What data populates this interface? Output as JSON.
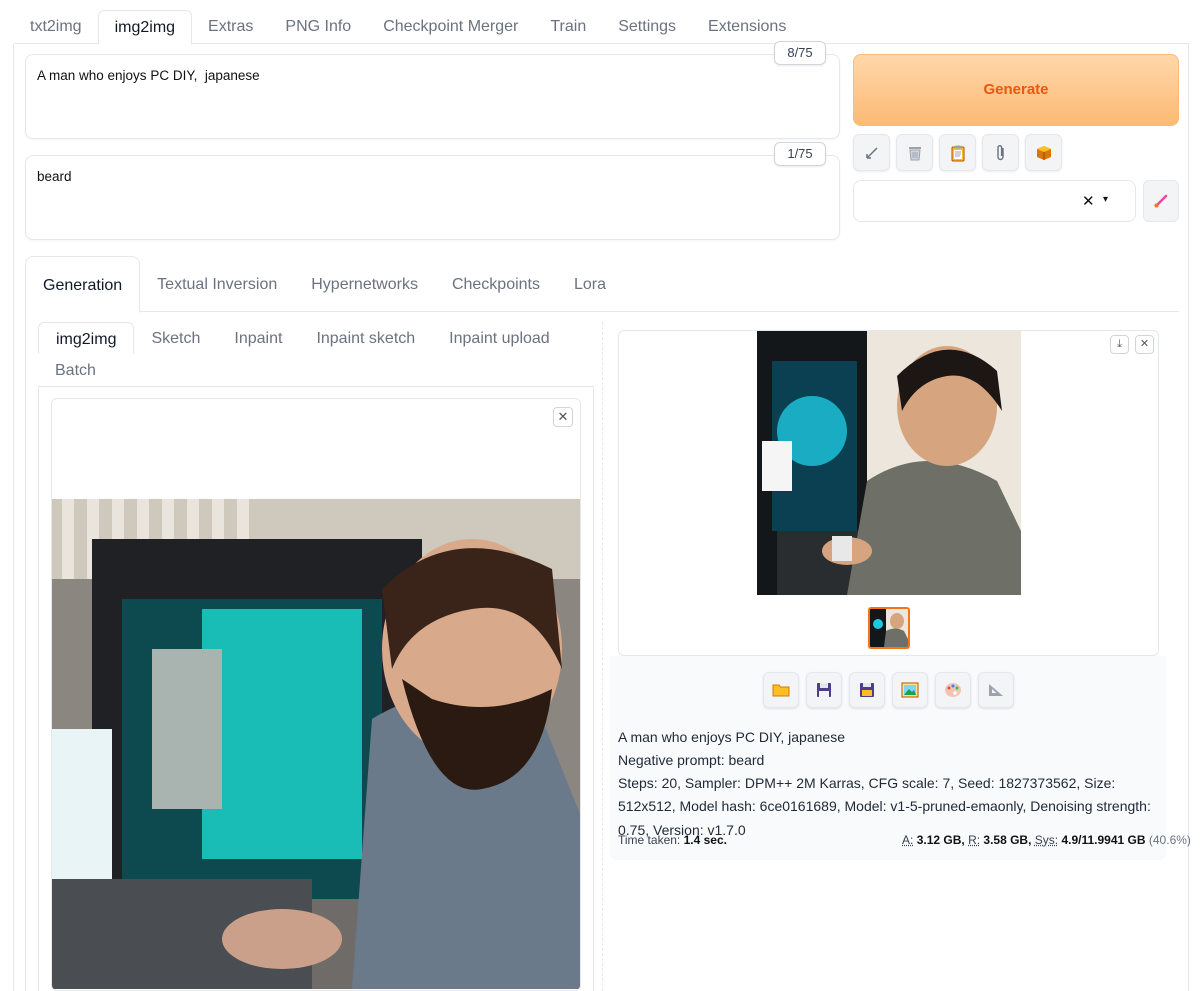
{
  "top_tabs": [
    "txt2img",
    "img2img",
    "Extras",
    "PNG Info",
    "Checkpoint Merger",
    "Train",
    "Settings",
    "Extensions"
  ],
  "prompt": {
    "text": "A man who enjoys PC DIY,  japanese",
    "counter": "8/75"
  },
  "negative_prompt": {
    "text": "beard",
    "counter": "1/75"
  },
  "generate_label": "Generate",
  "tool_buttons": [
    "arrow-icon",
    "trash-icon",
    "clipboard-icon",
    "paperclip-icon",
    "package-icon"
  ],
  "style_select": {
    "value": "",
    "clear_symbol": "✕",
    "caret": "▾"
  },
  "generation_tabs": [
    "Generation",
    "Textual Inversion",
    "Hypernetworks",
    "Checkpoints",
    "Lora"
  ],
  "sub_tabs": [
    "img2img",
    "Sketch",
    "Inpaint",
    "Inpaint sketch",
    "Inpaint upload",
    "Batch"
  ],
  "output_info": {
    "prompt": "A man who enjoys PC DIY, japanese",
    "negative": "Negative prompt: beard",
    "params": "Steps: 20, Sampler: DPM++ 2M Karras, CFG scale: 7, Seed: 1827373562, Size: 512x512, Model hash: 6ce0161689, Model: v1-5-pruned-emaonly, Denoising strength: 0.75, Version: v1.7.0"
  },
  "perf": {
    "time_label": "Time taken:",
    "time_value": "1.4 sec.",
    "a_label": "A:",
    "a_value": "3.12 GB,",
    "r_label": "R:",
    "r_value": "3.58 GB,",
    "sys_label": "Sys:",
    "sys_value": "4.9/11.9941 GB",
    "sys_pct": "(40.6%)"
  },
  "action_buttons": [
    "folder-icon",
    "save-icon",
    "zip-icon",
    "image-icon",
    "palette-icon",
    "ruler-icon"
  ],
  "colors": {
    "accent": "#ea580c",
    "generate_bg": "#fdba74"
  }
}
